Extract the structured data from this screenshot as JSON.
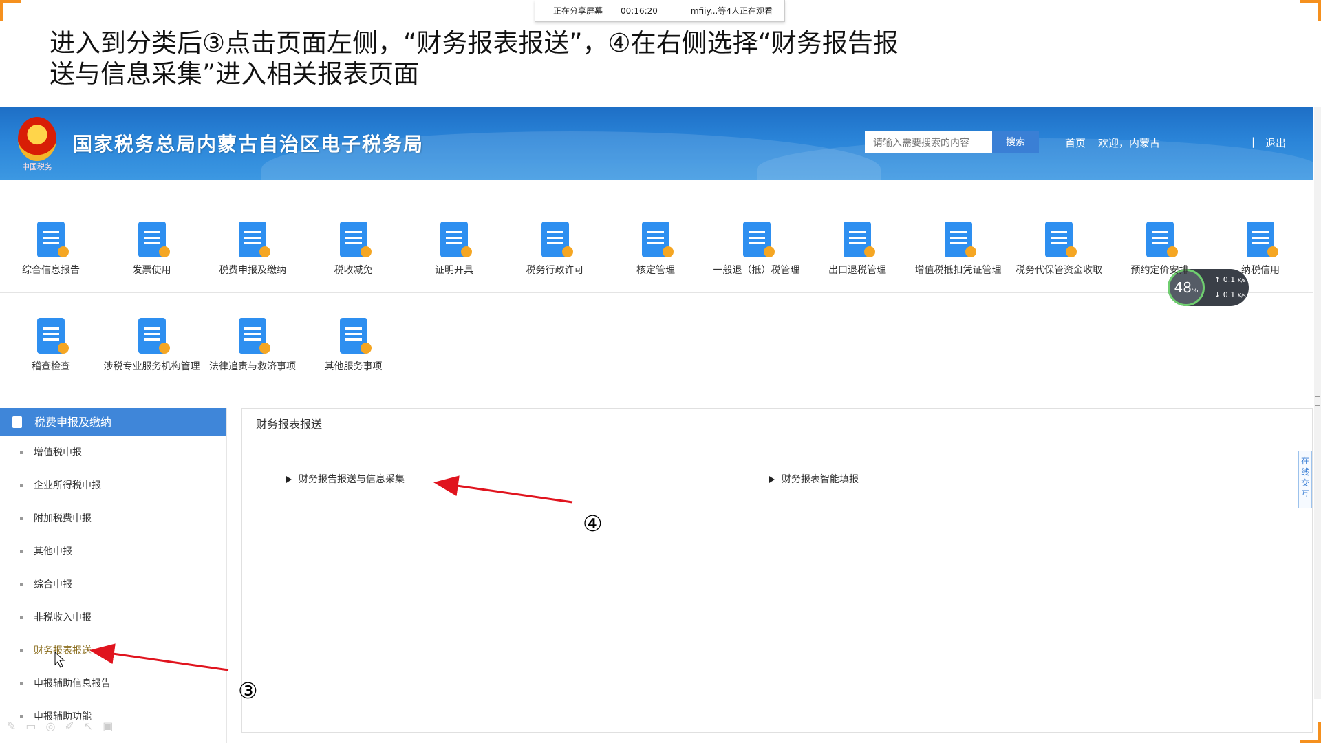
{
  "instruction": {
    "line1": "进入到分类后③点击页面左侧，“财务报表报送”，④在右侧选择“财务报告报",
    "line2": "送与信息采集”进入相关报表页面"
  },
  "share_bar": {
    "status": "正在分享屏幕",
    "time": "00:16:20",
    "viewers": "mfiiy...等4人正在观看"
  },
  "banner": {
    "site_title": "国家税务总局内蒙古自治区电子税务局",
    "emblem_caption": "中国税务",
    "search_placeholder": "请输入需要搜索的内容",
    "search_button": "搜索",
    "home_link": "首页",
    "welcome": "欢迎，内蒙古",
    "separator": "|",
    "exit": "退出"
  },
  "icon_grid": {
    "row1": [
      {
        "label": "综合信息报告",
        "icon": "clipboard-mic-icon"
      },
      {
        "label": "发票使用",
        "icon": "invoice-icon"
      },
      {
        "label": "税费申报及缴纳",
        "icon": "tax-payment-icon"
      },
      {
        "label": "税收减免",
        "icon": "tax-relief-icon"
      },
      {
        "label": "证明开具",
        "icon": "certificate-folder-icon"
      },
      {
        "label": "税务行政许可",
        "icon": "admin-permit-icon"
      },
      {
        "label": "核定管理",
        "icon": "verification-icon"
      },
      {
        "label": "一般退（抵）税管理",
        "icon": "refund-gear-icon"
      },
      {
        "label": "出口退税管理",
        "icon": "export-refund-icon"
      },
      {
        "label": "增值税抵扣凭证管理",
        "icon": "vat-deduction-icon"
      },
      {
        "label": "税务代保管资金收取",
        "icon": "coin-stack-icon"
      },
      {
        "label": "预约定价安排",
        "icon": "calendar-check-icon"
      },
      {
        "label": "纳税信用",
        "icon": "credit-shield-icon"
      }
    ],
    "row2": [
      {
        "label": "稽查检查",
        "icon": "inspection-shield-icon"
      },
      {
        "label": "涉税专业服务机构管理",
        "icon": "agency-building-icon"
      },
      {
        "label": "法律追责与救济事项",
        "icon": "law-book-icon"
      },
      {
        "label": "其他服务事项",
        "icon": "handshake-icon"
      }
    ]
  },
  "speed_widget": {
    "percent": "48",
    "unit": "%",
    "up": "0.1",
    "down": "0.1",
    "rate_unit": "K/s"
  },
  "sidebar": {
    "header": "税费申报及缴纳",
    "items": [
      {
        "label": "增值税申报"
      },
      {
        "label": "企业所得税申报"
      },
      {
        "label": "附加税费申报"
      },
      {
        "label": "其他申报"
      },
      {
        "label": "综合申报"
      },
      {
        "label": "非税收入申报"
      },
      {
        "label": "财务报表报送"
      },
      {
        "label": "申报辅助信息报告"
      },
      {
        "label": "申报辅助功能"
      }
    ]
  },
  "panel": {
    "title": "财务报表报送",
    "links": [
      {
        "label": "财务报告报送与信息采集"
      },
      {
        "label": "财务报表智能填报"
      }
    ]
  },
  "side_tab": {
    "label": "在线交互"
  },
  "annotations": {
    "step3": "③",
    "step4": "④"
  },
  "colors": {
    "banner": "#2a84d8",
    "menu_header": "#3f86d9",
    "arrow": "#e0141e",
    "corner": "#f5901e"
  }
}
